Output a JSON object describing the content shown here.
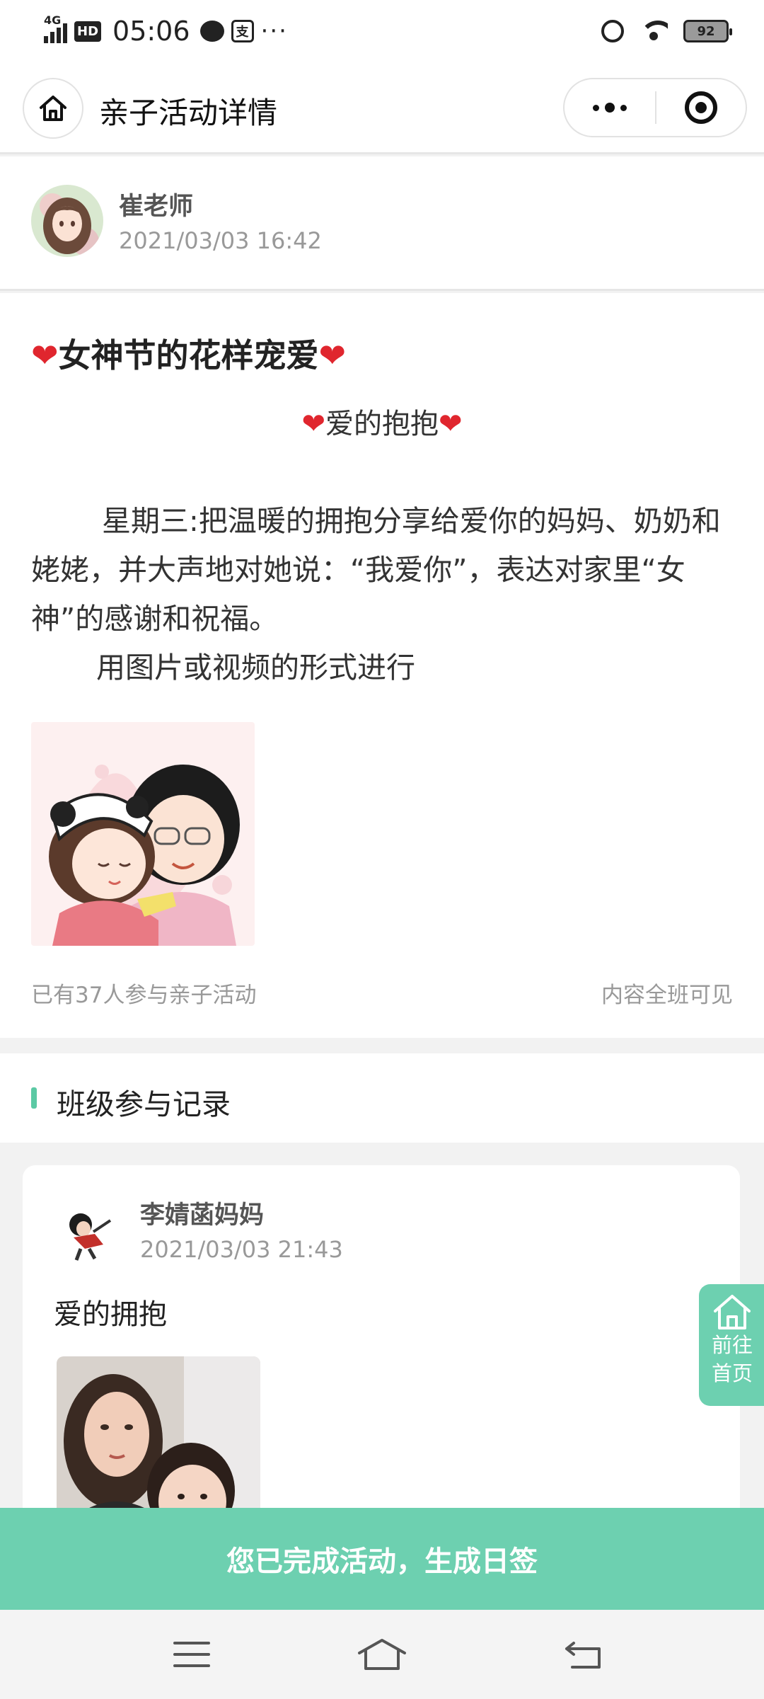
{
  "status_bar": {
    "network": "4G",
    "hd": "HD",
    "time": "05:06",
    "pay_icon": "支",
    "more": "···",
    "battery": "92"
  },
  "nav": {
    "title": "亲子活动详情"
  },
  "author": {
    "name": "崔老师",
    "time": "2021/03/03 16:42"
  },
  "article": {
    "title": "女神节的花样宠爱",
    "subtitle": "爱的抱抱",
    "paragraph1": "星期三:把温暖的拥抱分享给爱你的妈妈、奶奶和姥姥，并大声地对她说：“我爱你”，表达对家里“女神”的感谢和祝福。",
    "paragraph2": "用图片或视频的形式进行",
    "participants": "已有37人参与亲子活动",
    "visibility": "内容全班可见"
  },
  "section": {
    "title": "班级参与记录"
  },
  "records": [
    {
      "name": "李婧菡妈妈",
      "time": "2021/03/03 21:43",
      "text": "爱的拥抱"
    }
  ],
  "float_home": {
    "line1": "前往",
    "line2": "首页"
  },
  "action": {
    "label": "您已完成活动，生成日签"
  },
  "colors": {
    "accent": "#6dd0b0",
    "heart": "#e0262e"
  }
}
